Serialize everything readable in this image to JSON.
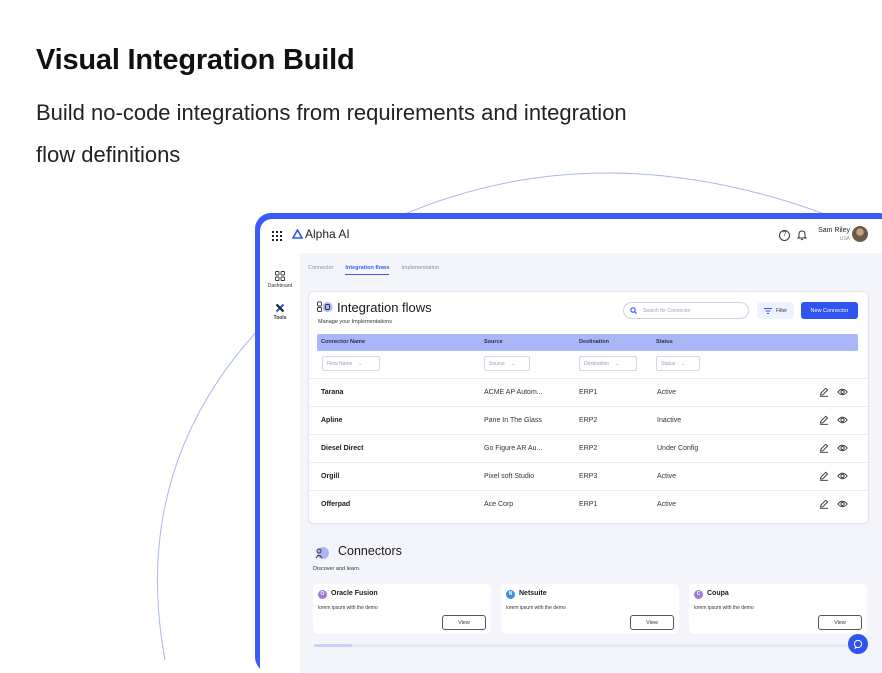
{
  "hero": {
    "title": "Visual Integration Build",
    "subtitle": "Build no-code integrations from requirements and integration flow definitions"
  },
  "app": {
    "brand": "Alpha AI",
    "accent_color": "#2f54f2",
    "user": {
      "name": "Sam Riley",
      "location": "USA"
    },
    "sidebar": [
      {
        "label": "Dashboard",
        "icon": "dashboard-icon"
      },
      {
        "label": "Tools",
        "icon": "tools-icon"
      }
    ],
    "tabs": [
      {
        "label": "Connector",
        "active": false
      },
      {
        "label": "Integration flows",
        "active": true
      },
      {
        "label": "Implementation",
        "active": false
      }
    ],
    "flows": {
      "title": "Integration flows",
      "subtitle": "Manage your Implementations",
      "search_placeholder": "Search for Connector",
      "filter_label": "Filter",
      "new_button": "New Connector",
      "columns": [
        "Connector Name",
        "Source",
        "Destination",
        "Status"
      ],
      "filters": [
        "Flow Name",
        "Source",
        "Destination",
        "Status"
      ],
      "rows": [
        {
          "name": "Tarana",
          "source": "ACME AP Autom...",
          "destination": "ERP1",
          "status": "Active"
        },
        {
          "name": "Apline",
          "source": "Pane In The Glass",
          "destination": "ERP2",
          "status": "Inactive"
        },
        {
          "name": "Diesel Direct",
          "source": "Go Figure AR Au...",
          "destination": "ERP2",
          "status": "Under Config"
        },
        {
          "name": "Orgill",
          "source": "Pixel soft Studio",
          "destination": "ERP3",
          "status": "Active"
        },
        {
          "name": "Offerpad",
          "source": "Ace Corp",
          "destination": "ERP1",
          "status": "Active"
        }
      ]
    },
    "connectors": {
      "title": "Connectors",
      "subtitle": "Discover and learn.",
      "cards": [
        {
          "name": "Oracle Fusion",
          "badge": "O",
          "color": "#9b7bdc",
          "desc": "lorem ipsum with the demo",
          "view": "View"
        },
        {
          "name": "Netsuite",
          "badge": "N",
          "color": "#3b8fe0",
          "desc": "lorem ipsum with the demo",
          "view": "View"
        },
        {
          "name": "Coupa",
          "badge": "C",
          "color": "#9b7bdc",
          "desc": "lorem ipsum with the demo",
          "view": "View"
        }
      ]
    }
  }
}
